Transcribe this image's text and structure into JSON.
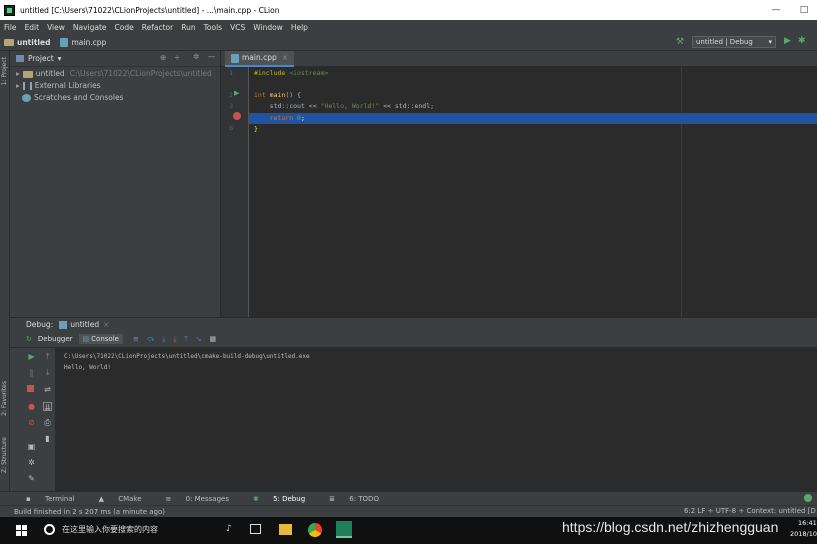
{
  "window": {
    "title": "untitled [C:\\Users\\71022\\CLionProjects\\untitled] - ...\\main.cpp - CLion",
    "minimize": "—",
    "maximize": "□"
  },
  "menu": [
    "File",
    "Edit",
    "View",
    "Navigate",
    "Code",
    "Refactor",
    "Run",
    "Tools",
    "VCS",
    "Window",
    "Help"
  ],
  "nav": {
    "project": "untitled",
    "file": "main.cpp",
    "run_config": "untitled | Debug"
  },
  "left_strip": {
    "project": "1: Project",
    "favorites": "2: Favorites",
    "structure": "Z: Structure"
  },
  "project_panel": {
    "title": "Project",
    "items": [
      {
        "label": "untitled",
        "path": "C:\\Users\\71022\\CLionProjects\\untitled"
      },
      {
        "label": "External Libraries",
        "path": ""
      },
      {
        "label": "Scratches and Consoles",
        "path": ""
      }
    ]
  },
  "editor": {
    "tab": "main.cpp",
    "line_numbers": [
      "1",
      "2",
      "3",
      "4",
      "5",
      "6"
    ],
    "lines": {
      "l1_pp": "#include ",
      "l1_hdr": "<iostream>",
      "l3_kw": "int ",
      "l3_fn": "main",
      "l3_rest": "() {",
      "l4_a": "    std::cout << ",
      "l4_str": "\"Hello, World!\"",
      "l4_b": " << std::endl;",
      "l5_kw": "    return ",
      "l5_num": "0",
      "l5_end": ";",
      "l6": "}"
    }
  },
  "debug": {
    "label": "Debug:",
    "session": "untitled",
    "tab_debugger": "Debugger",
    "tab_console": "Console",
    "console_lines": [
      "C:\\Users\\71022\\CLionProjects\\untitled\\cmake-build-debug\\untitled.exe",
      "Hello, World!"
    ]
  },
  "bottom_tabs": [
    "Terminal",
    "CMake",
    "0: Messages",
    "5: Debug",
    "6: TODO"
  ],
  "status": {
    "left": "Build finished in 2 s 207 ms (a minute ago)",
    "right": "6:2  LF ÷  UTF-8 ÷  Context: untitled [D"
  },
  "taskbar": {
    "search_placeholder": "在这里输入你要搜索的内容",
    "watermark": "https://blog.csdn.net/zhizhengguan",
    "time": "16:41",
    "date": "2018/10"
  },
  "colors": {
    "accent": "#4a88c7",
    "highlight_line": "#2154a0",
    "run_green": "#59a869",
    "breakpoint_red": "#c75450"
  }
}
